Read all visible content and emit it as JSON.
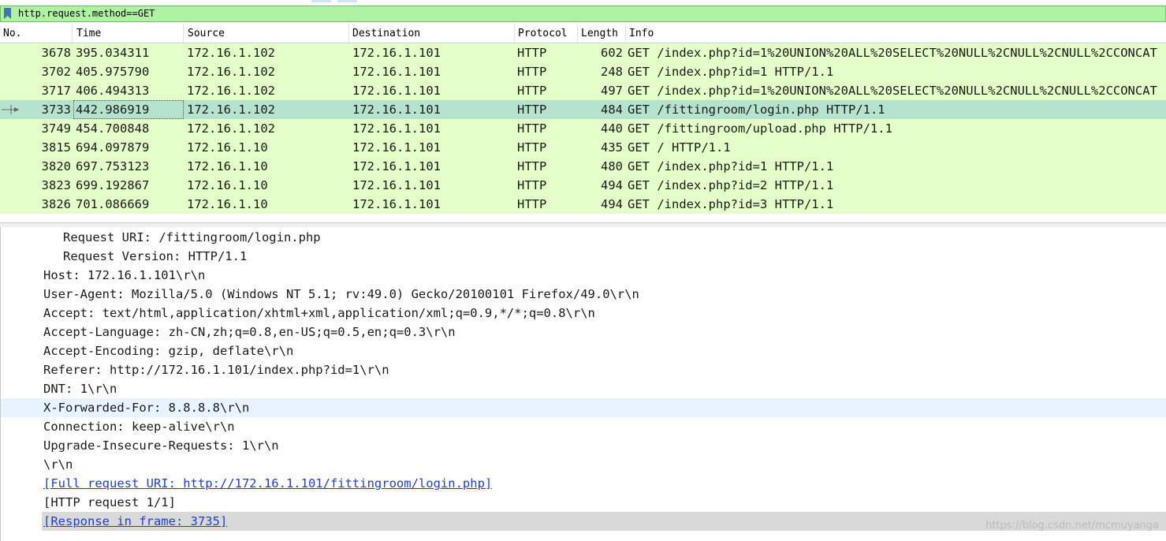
{
  "filter": {
    "text": "http.request.method==GET",
    "bookmark_icon": "bookmark-icon",
    "bg_color": "#aef2a2"
  },
  "columns": [
    "No.",
    "Time",
    "Source",
    "Destination",
    "Protocol",
    "Length",
    "Info"
  ],
  "packets": [
    {
      "no": "3678",
      "time": "395.034311",
      "src": "172.16.1.102",
      "dst": "172.16.1.101",
      "proto": "HTTP",
      "len": "602",
      "info": "GET /index.php?id=1%20UNION%20ALL%20SELECT%20NULL%2CNULL%2CNULL%2CCONCAT"
    },
    {
      "no": "3702",
      "time": "405.975790",
      "src": "172.16.1.102",
      "dst": "172.16.1.101",
      "proto": "HTTP",
      "len": "248",
      "info": "GET /index.php?id=1 HTTP/1.1"
    },
    {
      "no": "3717",
      "time": "406.494313",
      "src": "172.16.1.102",
      "dst": "172.16.1.101",
      "proto": "HTTP",
      "len": "497",
      "info": "GET /index.php?id=1%20UNION%20ALL%20SELECT%20NULL%2CNULL%2CNULL%2CCONCAT"
    },
    {
      "no": "3733",
      "time": "442.986919",
      "src": "172.16.1.102",
      "dst": "172.16.1.101",
      "proto": "HTTP",
      "len": "484",
      "info": "GET /fittingroom/login.php HTTP/1.1",
      "selected": true
    },
    {
      "no": "3749",
      "time": "454.700848",
      "src": "172.16.1.102",
      "dst": "172.16.1.101",
      "proto": "HTTP",
      "len": "440",
      "info": "GET /fittingroom/upload.php HTTP/1.1"
    },
    {
      "no": "3815",
      "time": "694.097879",
      "src": "172.16.1.10",
      "dst": "172.16.1.101",
      "proto": "HTTP",
      "len": "435",
      "info": "GET / HTTP/1.1"
    },
    {
      "no": "3820",
      "time": "697.753123",
      "src": "172.16.1.10",
      "dst": "172.16.1.101",
      "proto": "HTTP",
      "len": "480",
      "info": "GET /index.php?id=1 HTTP/1.1"
    },
    {
      "no": "3823",
      "time": "699.192867",
      "src": "172.16.1.10",
      "dst": "172.16.1.101",
      "proto": "HTTP",
      "len": "494",
      "info": "GET /index.php?id=2 HTTP/1.1"
    },
    {
      "no": "3826",
      "time": "701.086669",
      "src": "172.16.1.10",
      "dst": "172.16.1.101",
      "proto": "HTTP",
      "len": "494",
      "info": "GET /index.php?id=3 HTTP/1.1"
    }
  ],
  "details": {
    "request_uri": "Request URI: /fittingroom/login.php",
    "request_version": "Request Version: HTTP/1.1",
    "host": "Host: 172.16.1.101\\r\\n",
    "user_agent": "User-Agent: Mozilla/5.0 (Windows NT 5.1; rv:49.0) Gecko/20100101 Firefox/49.0\\r\\n",
    "accept": "Accept: text/html,application/xhtml+xml,application/xml;q=0.9,*/*;q=0.8\\r\\n",
    "accept_language": "Accept-Language: zh-CN,zh;q=0.8,en-US;q=0.5,en;q=0.3\\r\\n",
    "accept_encoding": "Accept-Encoding: gzip, deflate\\r\\n",
    "referer": "Referer: http://172.16.1.101/index.php?id=1\\r\\n",
    "dnt": "DNT: 1\\r\\n",
    "x_forwarded_for": "X-Forwarded-For: 8.8.8.8\\r\\n",
    "connection": "Connection: keep-alive\\r\\n",
    "upgrade": "Upgrade-Insecure-Requests: 1\\r\\n",
    "crlf": "\\r\\n",
    "full_uri": "[Full request URI: http://172.16.1.101/fittingroom/login.php]",
    "http_request": "[HTTP request 1/1]",
    "response_in": "[Response in frame: 3735]"
  },
  "watermark": "https://blog.csdn.net/mcmuyanga",
  "colors": {
    "row_bg": "#e4ffc7",
    "selected_row_bg": "#b6e3ce",
    "link": "#1a3fd6"
  }
}
